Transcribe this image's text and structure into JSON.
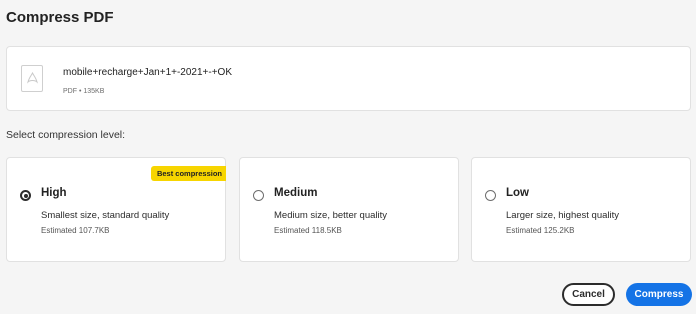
{
  "dialog": {
    "title": "Compress PDF"
  },
  "file": {
    "name": "mobile+recharge+Jan+1+-2021+-+OK",
    "meta": "PDF • 135KB",
    "icon": "pdf-file-icon"
  },
  "compression": {
    "label": "Select compression level:",
    "selected": "High",
    "options": [
      {
        "title": "High",
        "description": "Smallest size, standard quality",
        "estimate": "Estimated 107.7KB",
        "badge": "Best compression",
        "checked": true
      },
      {
        "title": "Medium",
        "description": "Medium size, better quality",
        "estimate": "Estimated 118.5KB",
        "checked": false
      },
      {
        "title": "Low",
        "description": "Larger size, highest quality",
        "estimate": "Estimated 125.2KB",
        "checked": false
      }
    ]
  },
  "actions": {
    "cancel_label": "Cancel",
    "compress_label": "Compress"
  },
  "colors": {
    "primary": "#1473e6",
    "badge": "#f7d500",
    "background": "#f5f5f5"
  }
}
